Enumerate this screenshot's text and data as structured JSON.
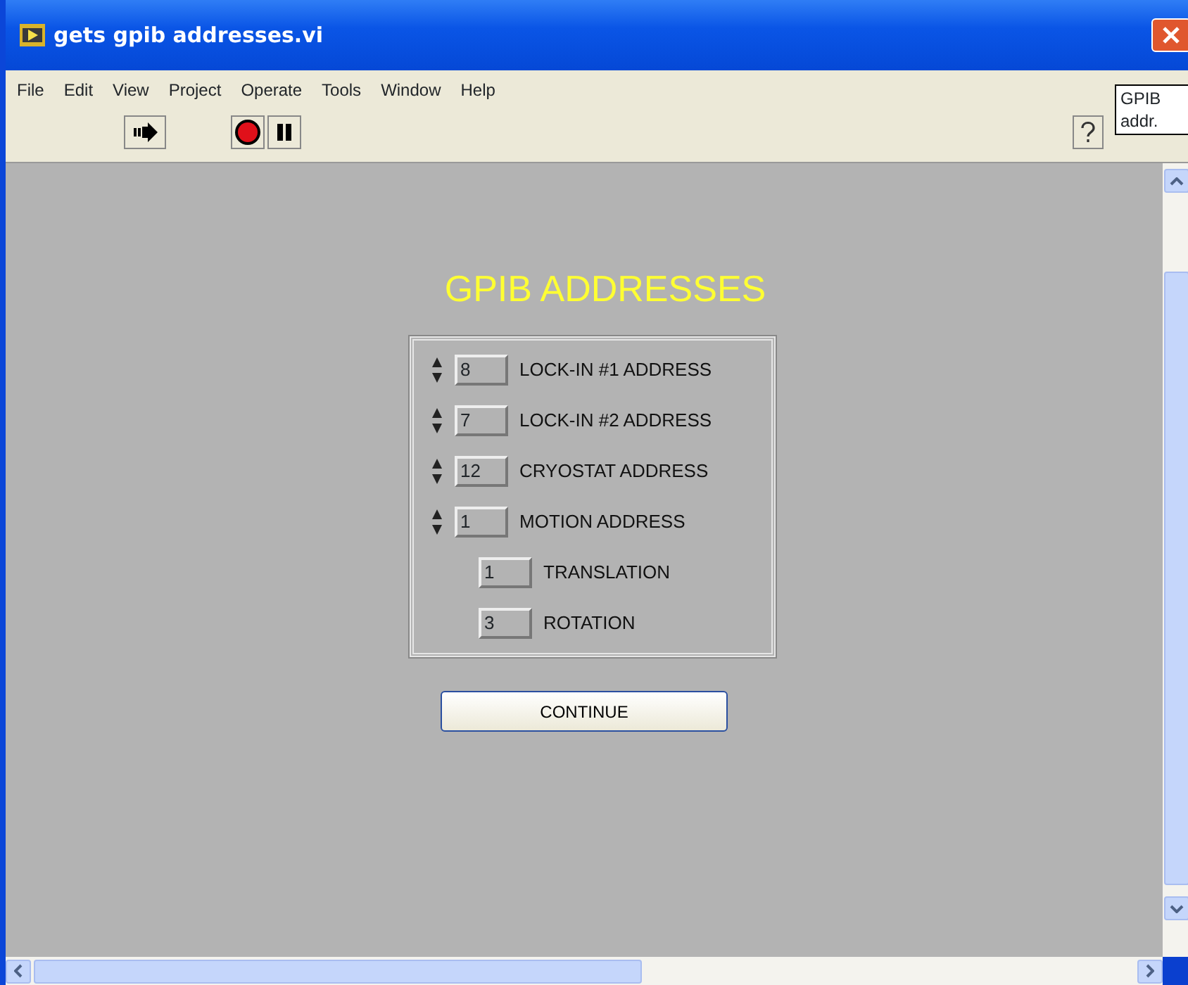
{
  "window": {
    "title": "gets gpib addresses.vi"
  },
  "menu": [
    "File",
    "Edit",
    "View",
    "Project",
    "Operate",
    "Tools",
    "Window",
    "Help"
  ],
  "icon_label": "GPIB addr.",
  "panel": {
    "title": "GPIB ADDRESSES",
    "controls": [
      {
        "kind": "numeric",
        "value": "8",
        "label": "LOCK-IN #1 ADDRESS"
      },
      {
        "kind": "numeric",
        "value": "7",
        "label": "LOCK-IN #2 ADDRESS"
      },
      {
        "kind": "numeric",
        "value": "12",
        "label": "CRYOSTAT ADDRESS"
      },
      {
        "kind": "numeric",
        "value": "1",
        "label": "MOTION ADDRESS"
      },
      {
        "kind": "indicator",
        "value": "1",
        "label": "TRANSLATION"
      },
      {
        "kind": "indicator",
        "value": "3",
        "label": "ROTATION"
      }
    ],
    "button": "CONTINUE"
  }
}
